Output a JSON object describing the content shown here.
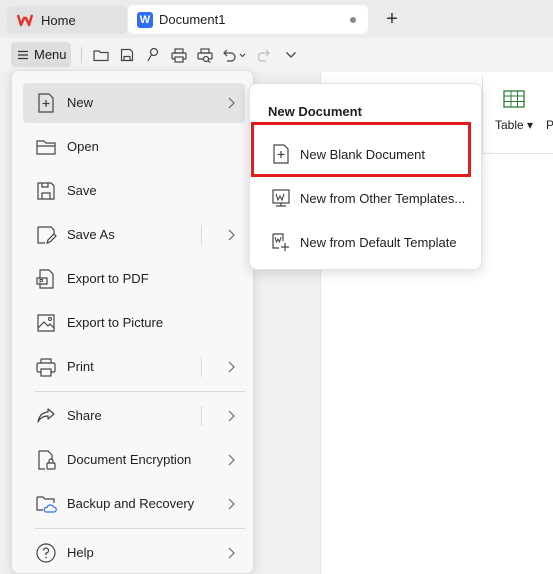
{
  "tabs": {
    "home_label": "Home",
    "document_label": "Document1",
    "add_symbol": "+"
  },
  "toolbar": {
    "menu_label": "Menu",
    "icons": [
      "open-folder-icon",
      "save-icon",
      "format-painter-icon",
      "print-icon",
      "print-preview-icon",
      "undo-icon",
      "redo-icon",
      "more-dropdown-icon"
    ]
  },
  "ribbon": {
    "table_label": "Table",
    "cut_off_label": "P"
  },
  "menu": {
    "items": [
      {
        "label": "New",
        "icon": "new-file-icon",
        "has_submenu": true
      },
      {
        "label": "Open",
        "icon": "folder-icon",
        "has_submenu": false
      },
      {
        "label": "Save",
        "icon": "save-icon",
        "has_submenu": false
      },
      {
        "label": "Save As",
        "icon": "save-as-icon",
        "has_submenu": true
      },
      {
        "label": "Export to PDF",
        "icon": "pdf-icon",
        "has_submenu": false
      },
      {
        "label": "Export to Picture",
        "icon": "picture-icon",
        "has_submenu": false
      },
      {
        "label": "Print",
        "icon": "print-icon",
        "has_submenu": true
      },
      {
        "label": "Share",
        "icon": "share-icon",
        "has_submenu": true
      },
      {
        "label": "Document Encryption",
        "icon": "encryption-icon",
        "has_submenu": true
      },
      {
        "label": "Backup and Recovery",
        "icon": "backup-icon",
        "has_submenu": true
      },
      {
        "label": "Help",
        "icon": "help-icon",
        "has_submenu": true
      }
    ]
  },
  "submenu": {
    "title": "New Document",
    "items": [
      {
        "label": "New Blank Document",
        "icon": "blank-document-icon"
      },
      {
        "label": "New from Other Templates...",
        "icon": "template-icon"
      },
      {
        "label": "New from Default Template",
        "icon": "default-template-icon"
      }
    ]
  },
  "colors": {
    "highlight": "#e21b1b",
    "wps_red": "#e8332a",
    "word_blue": "#2f6ff3"
  }
}
